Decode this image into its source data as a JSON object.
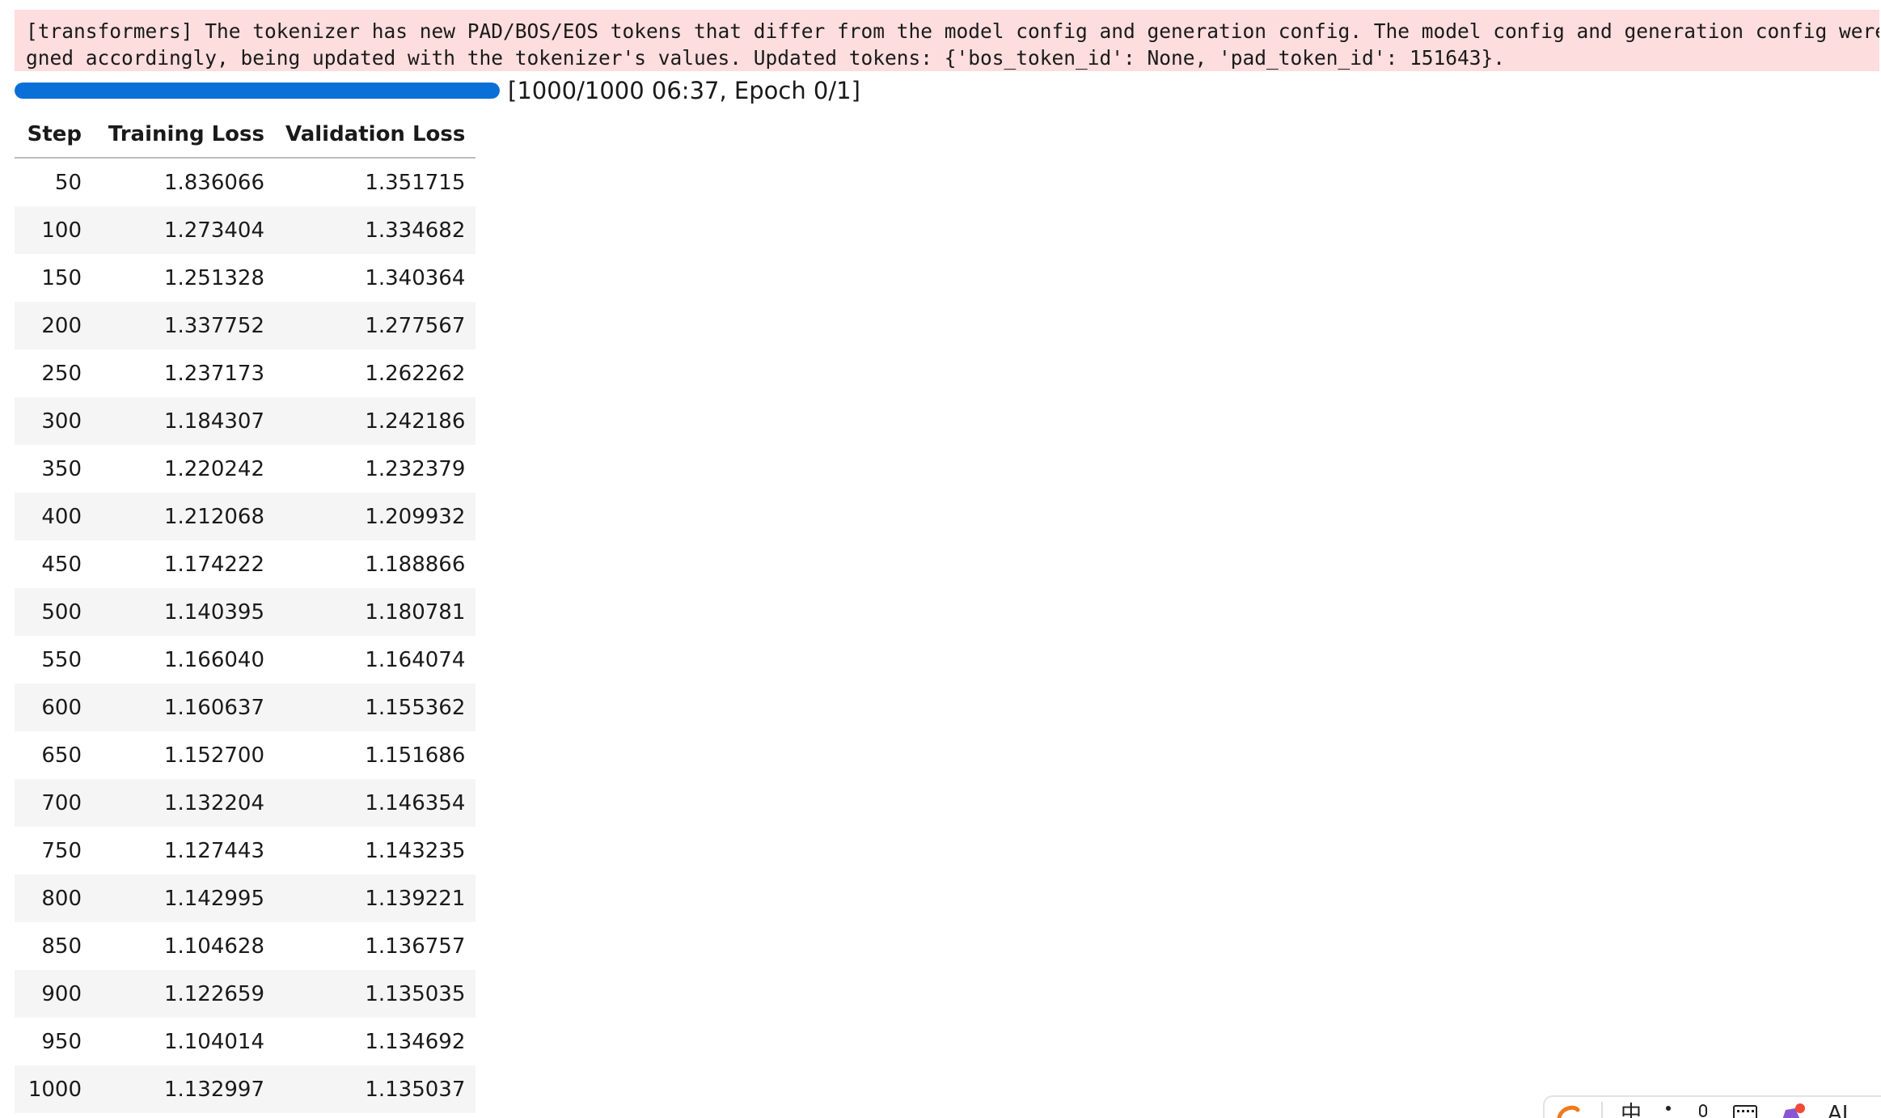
{
  "stderr": {
    "line1": "[transformers] The tokenizer has new PAD/BOS/EOS tokens that differ from the model config and generation config. The model config and generation config were ali",
    "line2": "gned accordingly, being updated with the tokenizer's values. Updated tokens: {'bos_token_id': None, 'pad_token_id': 151643}."
  },
  "progress": {
    "fraction": 1.0,
    "text": "[1000/1000 06:37, Epoch 0/1]",
    "color": "#0a6fd6"
  },
  "table": {
    "headers": [
      "Step",
      "Training Loss",
      "Validation Loss"
    ],
    "rows": [
      [
        "50",
        "1.836066",
        "1.351715"
      ],
      [
        "100",
        "1.273404",
        "1.334682"
      ],
      [
        "150",
        "1.251328",
        "1.340364"
      ],
      [
        "200",
        "1.337752",
        "1.277567"
      ],
      [
        "250",
        "1.237173",
        "1.262262"
      ],
      [
        "300",
        "1.184307",
        "1.242186"
      ],
      [
        "350",
        "1.220242",
        "1.232379"
      ],
      [
        "400",
        "1.212068",
        "1.209932"
      ],
      [
        "450",
        "1.174222",
        "1.188866"
      ],
      [
        "500",
        "1.140395",
        "1.180781"
      ],
      [
        "550",
        "1.166040",
        "1.164074"
      ],
      [
        "600",
        "1.160637",
        "1.155362"
      ],
      [
        "650",
        "1.152700",
        "1.151686"
      ],
      [
        "700",
        "1.132204",
        "1.146354"
      ],
      [
        "750",
        "1.127443",
        "1.143235"
      ],
      [
        "800",
        "1.142995",
        "1.139221"
      ],
      [
        "850",
        "1.104628",
        "1.136757"
      ],
      [
        "900",
        "1.122659",
        "1.135035"
      ],
      [
        "950",
        "1.104014",
        "1.134692"
      ],
      [
        "1000",
        "1.132997",
        "1.135037"
      ]
    ]
  },
  "taskbar": {
    "icons": [
      "sogou-ime-icon",
      "chinese-input-mode-icon",
      "punctuation-icon",
      "microphone-icon",
      "keyboard-icon",
      "skin-icon",
      "ai-assistant-icon"
    ],
    "ime_mode_label": "中",
    "ai_label": "AI"
  }
}
